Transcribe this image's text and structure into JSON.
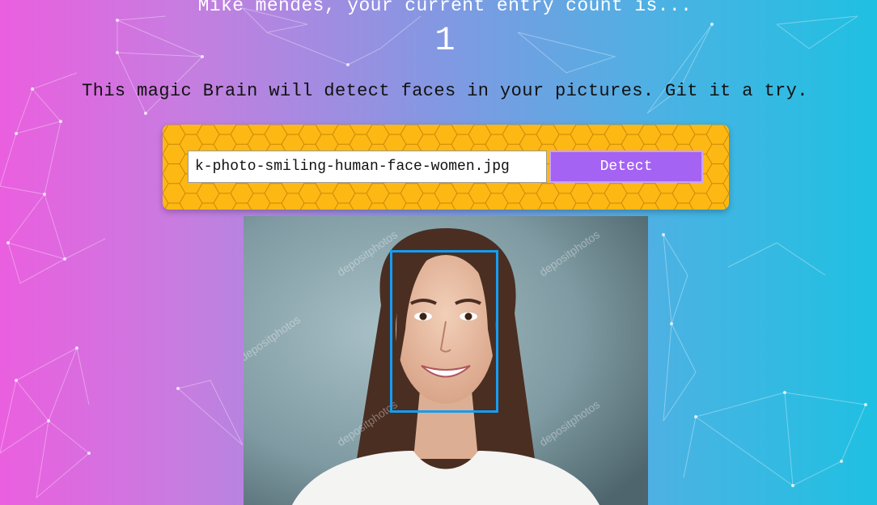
{
  "header": {
    "entry_message": "Mike mendes, your current entry count is...",
    "entry_count": "1"
  },
  "tagline": "This magic Brain will detect faces in your pictures. Git it a try.",
  "form": {
    "image_url_value": "k-photo-smiling-human-face-women.jpg",
    "detect_label": "Detect"
  },
  "photo": {
    "watermark": "depositphotos"
  },
  "colors": {
    "gradient_left": "#ea5fdf",
    "gradient_right": "#1fc0e2",
    "panel": "#fdb813",
    "button": "#a463f2",
    "face_box": "#149df2"
  }
}
